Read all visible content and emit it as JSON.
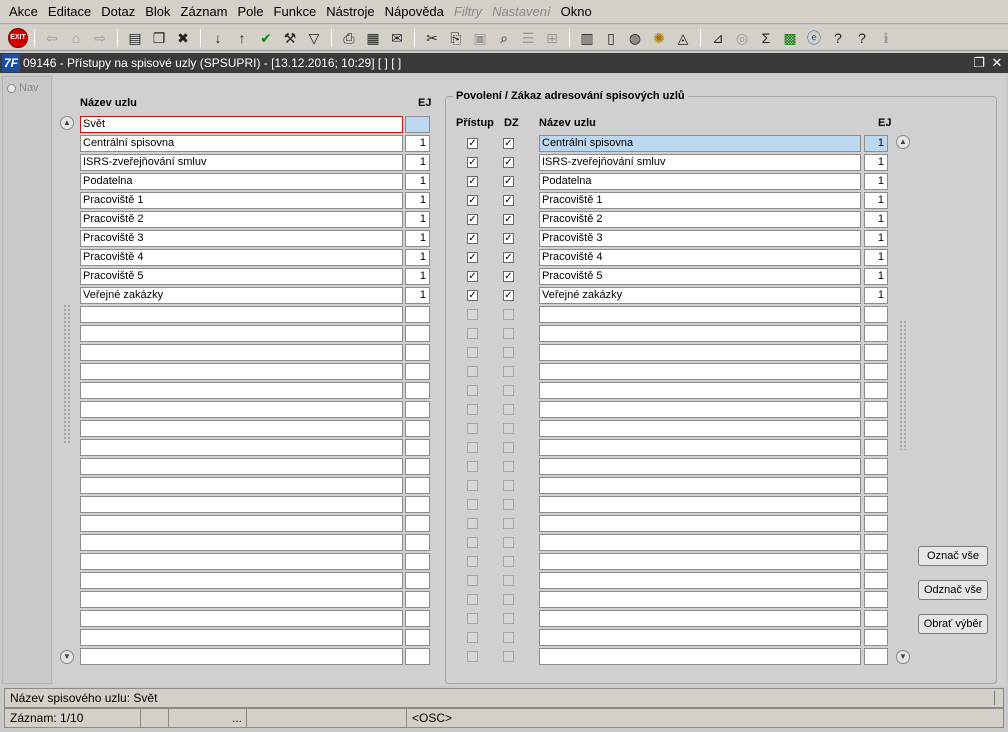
{
  "menu": [
    "Akce",
    "Editace",
    "Dotaz",
    "Blok",
    "Záznam",
    "Pole",
    "Funkce",
    "Nástroje",
    "Nápověda",
    "Filtry",
    "Nastavení",
    "Okno"
  ],
  "menu_disabled": [
    "Filtry",
    "Nastavení"
  ],
  "toolbar": {
    "exit_label": "EXIT",
    "icons": [
      "print-icon",
      "scissors-icon",
      "checkmark-icon",
      "filter-icon",
      "sort-asc-icon",
      "sort-desc-icon",
      "sum-icon",
      "help-icon",
      "info-icon"
    ],
    "sum_glyph": "Σ"
  },
  "window": {
    "title": "09146 - Přístupy na spisové uzly (SPSUPRI) - [13.12.2016; 10:29]  [ ]  [ ]",
    "logo": "7F"
  },
  "nav": {
    "label": "Nav"
  },
  "left_table": {
    "col_name": "Název uzlu",
    "col_ej": "EJ",
    "rows": [
      {
        "name": "Svět",
        "ej": ""
      },
      {
        "name": "Centrální spisovna",
        "ej": "1"
      },
      {
        "name": "ISRS-zveřejňování smluv",
        "ej": "1"
      },
      {
        "name": "Podatelna",
        "ej": "1"
      },
      {
        "name": "Pracoviště 1",
        "ej": "1"
      },
      {
        "name": "Pracoviště 2",
        "ej": "1"
      },
      {
        "name": "Pracoviště 3",
        "ej": "1"
      },
      {
        "name": "Pracoviště 4",
        "ej": "1"
      },
      {
        "name": "Pracoviště 5",
        "ej": "1"
      },
      {
        "name": "Veřejné zakázky",
        "ej": "1"
      }
    ]
  },
  "right_table": {
    "group_title": "Povolení / Zákaz adresování spisových uzlů",
    "col_access": "Přístup",
    "col_dz": "DZ",
    "col_name": "Název uzlu",
    "col_ej": "EJ",
    "rows": [
      {
        "access": true,
        "dz": true,
        "name": "Centrální spisovna",
        "ej": "1"
      },
      {
        "access": true,
        "dz": true,
        "name": "ISRS-zveřejňování smluv",
        "ej": "1"
      },
      {
        "access": true,
        "dz": true,
        "name": "Podatelna",
        "ej": "1"
      },
      {
        "access": true,
        "dz": true,
        "name": "Pracoviště 1",
        "ej": "1"
      },
      {
        "access": true,
        "dz": true,
        "name": "Pracoviště 2",
        "ej": "1"
      },
      {
        "access": true,
        "dz": true,
        "name": "Pracoviště 3",
        "ej": "1"
      },
      {
        "access": true,
        "dz": true,
        "name": "Pracoviště 4",
        "ej": "1"
      },
      {
        "access": true,
        "dz": true,
        "name": "Pracoviště 5",
        "ej": "1"
      },
      {
        "access": true,
        "dz": true,
        "name": "Veřejné zakázky",
        "ej": "1"
      }
    ]
  },
  "buttons": {
    "select_all": "Označ vše",
    "deselect_all": "Odznač vše",
    "invert": "Obrať výběr"
  },
  "status": {
    "message": "Název spisového uzlu: Svět",
    "record": "Záznam: 1/10",
    "ellipsis": "...",
    "mode": "<OSC>"
  },
  "colors": {
    "selected_row": "#bcd8f0",
    "focus_border": "#d01010",
    "title_bar": "#3a3a3a"
  }
}
